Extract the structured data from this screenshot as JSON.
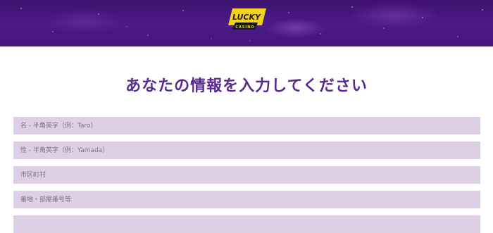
{
  "header": {
    "logo": {
      "text_main": "LUCKY",
      "text_sub": "CASINO"
    }
  },
  "form": {
    "title": "あなたの情報を入力してください",
    "fields": [
      {
        "placeholder": "名 - 半角英字（例：Taro）",
        "value": ""
      },
      {
        "placeholder": "性 - 半角英字（例：Yamada）",
        "value": ""
      },
      {
        "placeholder": "市区町村",
        "value": ""
      },
      {
        "placeholder": "番地・部屋番号等",
        "value": ""
      },
      {
        "placeholder": "",
        "value": ""
      }
    ]
  },
  "colors": {
    "header_bg": "#4b1a86",
    "title": "#5a2a8f",
    "field_bg": "#ddd0e6",
    "logo_yellow": "#f2d21a"
  }
}
